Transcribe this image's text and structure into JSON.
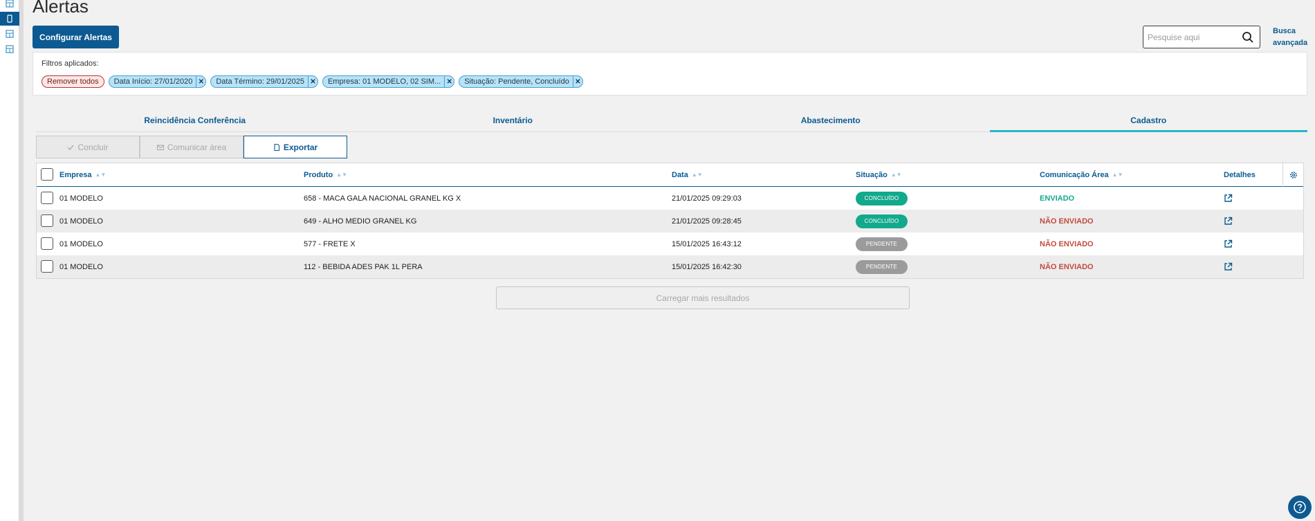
{
  "sidebar": {
    "items": [
      {
        "icon": "table-icon",
        "active": false
      },
      {
        "icon": "mobile-icon",
        "active": true
      },
      {
        "icon": "table-icon",
        "active": false
      },
      {
        "icon": "table-icon",
        "active": false
      }
    ]
  },
  "page": {
    "title": "Alertas"
  },
  "actions": {
    "configure_label": "Configurar Alertas"
  },
  "search": {
    "placeholder": "Pesquise aqui",
    "advanced_line1": "Busca",
    "advanced_line2": "avançada"
  },
  "filters": {
    "label": "Filtros aplicados:",
    "remove_all": "Remover todos",
    "chips": [
      "Data Início: 27/01/2020",
      "Data Término: 29/01/2025",
      "Empresa: 01 MODELO, 02 SIM...",
      "Situação: Pendente, Concluído"
    ]
  },
  "tabs": [
    {
      "label": "Reincidência Conferência",
      "active": false
    },
    {
      "label": "Inventário",
      "active": false
    },
    {
      "label": "Abastecimento",
      "active": false
    },
    {
      "label": "Cadastro",
      "active": true
    }
  ],
  "toolbar": {
    "conclude": "Concluir",
    "communicate": "Comunicar área",
    "export": "Exportar"
  },
  "table": {
    "headers": {
      "empresa": "Empresa",
      "produto": "Produto",
      "data": "Data",
      "situacao": "Situação",
      "comunicacao": "Comunicação Área",
      "detalhes": "Detalhes"
    },
    "rows": [
      {
        "empresa": "01 MODELO",
        "produto": "658 - MACA GALA NACIONAL GRANEL KG X",
        "data": "21/01/2025 09:29:03",
        "situacao": "CONCLUÍDO",
        "comunicacao": "ENVIADO"
      },
      {
        "empresa": "01 MODELO",
        "produto": "649 - ALHO MEDIO GRANEL KG",
        "data": "21/01/2025 09:28:45",
        "situacao": "CONCLUÍDO",
        "comunicacao": "NÃO ENVIADO"
      },
      {
        "empresa": "01 MODELO",
        "produto": "577 - FRETE X",
        "data": "15/01/2025 16:43:12",
        "situacao": "PENDENTE",
        "comunicacao": "NÃO ENVIADO"
      },
      {
        "empresa": "01 MODELO",
        "produto": "112 - BEBIDA ADES PAK 1L PERA",
        "data": "15/01/2025 16:42:30",
        "situacao": "PENDENTE",
        "comunicacao": "NÃO ENVIADO"
      }
    ]
  },
  "load_more": "Carregar mais resultados",
  "colors": {
    "primary": "#0c5a91",
    "concluded": "#12a98c",
    "pending": "#9b9b9b",
    "not_sent": "#c24a3d",
    "tab_indicator": "#29b6c8"
  }
}
